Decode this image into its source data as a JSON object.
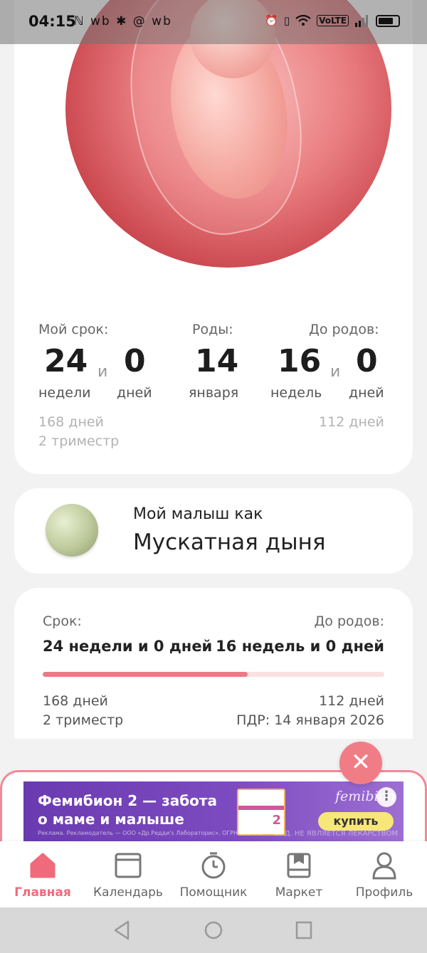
{
  "status_bar": {
    "time": "04:15",
    "left_icons": "ℕ wb ✱ @ wb",
    "volte": "VoLTE",
    "icons": [
      "alarm-icon",
      "vibrate-icon",
      "wifi-icon",
      "volte-icon",
      "signal-icon",
      "battery-icon"
    ]
  },
  "pregnancy": {
    "my_term_label": "Мой срок:",
    "weeks_value": "24",
    "and": "и",
    "days_value": "0",
    "weeks_unit": "недели",
    "days_unit": "дней",
    "birth_label": "Роды:",
    "birth_day": "14",
    "birth_month": "января",
    "until_label": "До родов:",
    "until_weeks": "16",
    "until_days": "0",
    "until_weeks_unit": "недель",
    "until_days_unit": "дней",
    "total_days": "168 дней",
    "trimester": "2 триместр",
    "remaining_days": "112 дней"
  },
  "baby": {
    "small_text": "Мой малыш как",
    "fruit": "Мускатная дыня"
  },
  "term": {
    "label": "Срок:",
    "value": "24 недели и 0 дней",
    "until_label": "До родов:",
    "until_value": "16 недель и 0 дней",
    "progress": 0.6,
    "days": "168 дней",
    "trimester": "2 триместр",
    "remaining": "112 дней",
    "pdr": "ПДР: 14 января 2026"
  },
  "ad": {
    "title": "Фемибион 2 — забота о маме и малыше",
    "brand": "femibion",
    "buy": "купить",
    "legal": "Реклама. Рекламодатель — ООО «Др.Редди's Лабораторис». ОГРН 103770",
    "disclaimer": "БАД. НЕ ЯВЛЯЕТСЯ ЛЕКАРСТВОМ",
    "box_number": "2",
    "more": "⋮"
  },
  "nav": [
    {
      "label": "Главная",
      "icon": "home-icon",
      "active": true
    },
    {
      "label": "Календарь",
      "icon": "calendar-icon",
      "active": false
    },
    {
      "label": "Помощник",
      "icon": "timer-icon",
      "active": false
    },
    {
      "label": "Маркет",
      "icon": "market-icon",
      "active": false
    },
    {
      "label": "Профиль",
      "icon": "profile-icon",
      "active": false
    }
  ],
  "colors": {
    "accent": "#ef6b7b",
    "progress_fill": "#eb7a87",
    "ad_bg": "#6a3ab0"
  }
}
